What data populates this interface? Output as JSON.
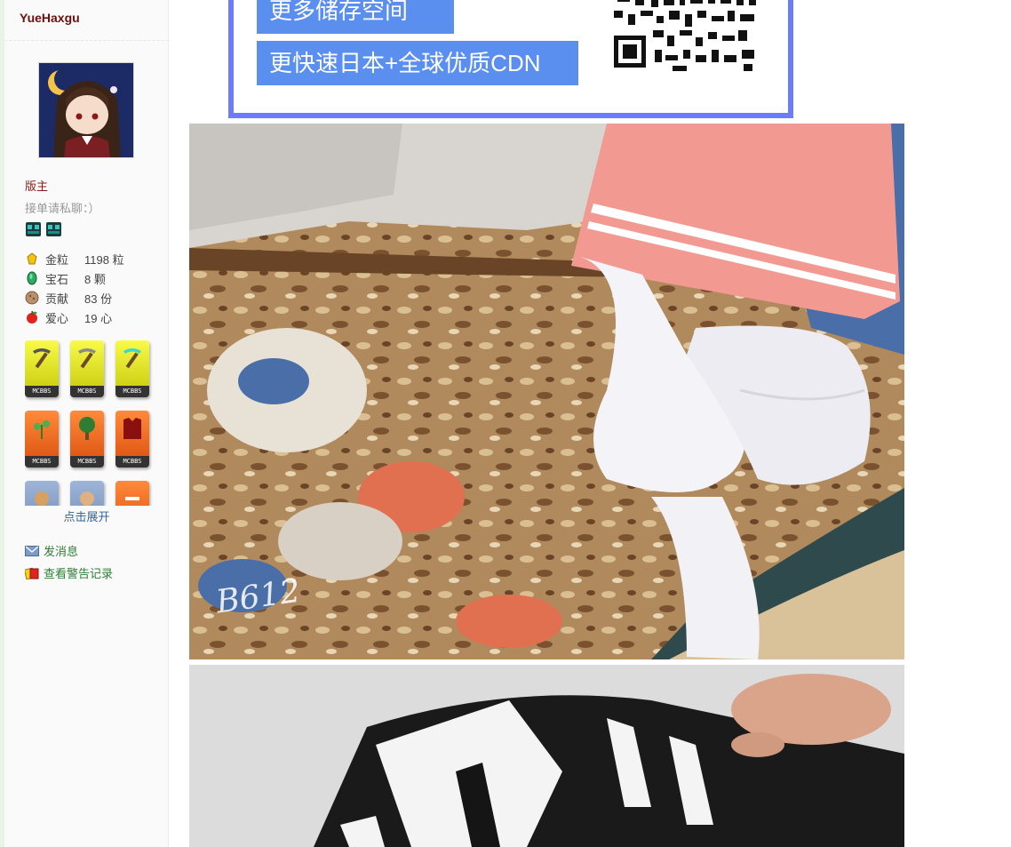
{
  "user": {
    "username": "YueHaxgu",
    "rank": "版主",
    "signature": "接单请私聊：）",
    "badge_icons": [
      "creeper-badge-icon",
      "creeper-badge-icon"
    ]
  },
  "stats": [
    {
      "icon": "gold-nugget-icon",
      "name": "金粒",
      "value": "1198 粒"
    },
    {
      "icon": "emerald-icon",
      "name": "宝石",
      "value": "8 颗"
    },
    {
      "icon": "contribution-icon",
      "name": "贡献",
      "value": "83 份"
    },
    {
      "icon": "apple-heart-icon",
      "name": "爱心",
      "value": "19 心"
    }
  ],
  "medals": {
    "tag_text": "MCBBS",
    "expand_label": "点击展开"
  },
  "actions": {
    "send_message": "发消息",
    "view_warnings": "查看警告记录"
  },
  "ad": {
    "line1": "更多储存空间",
    "line2": "更快速日本+全球优质CDN",
    "border_color": "#6d7bff",
    "button_color": "#5a8eef"
  },
  "photos": {
    "watermark": "B612"
  },
  "colors": {
    "username": "#6b1010",
    "rank": "#8a1a1a",
    "link_green": "#2e7d32",
    "link_blue": "#336699"
  }
}
